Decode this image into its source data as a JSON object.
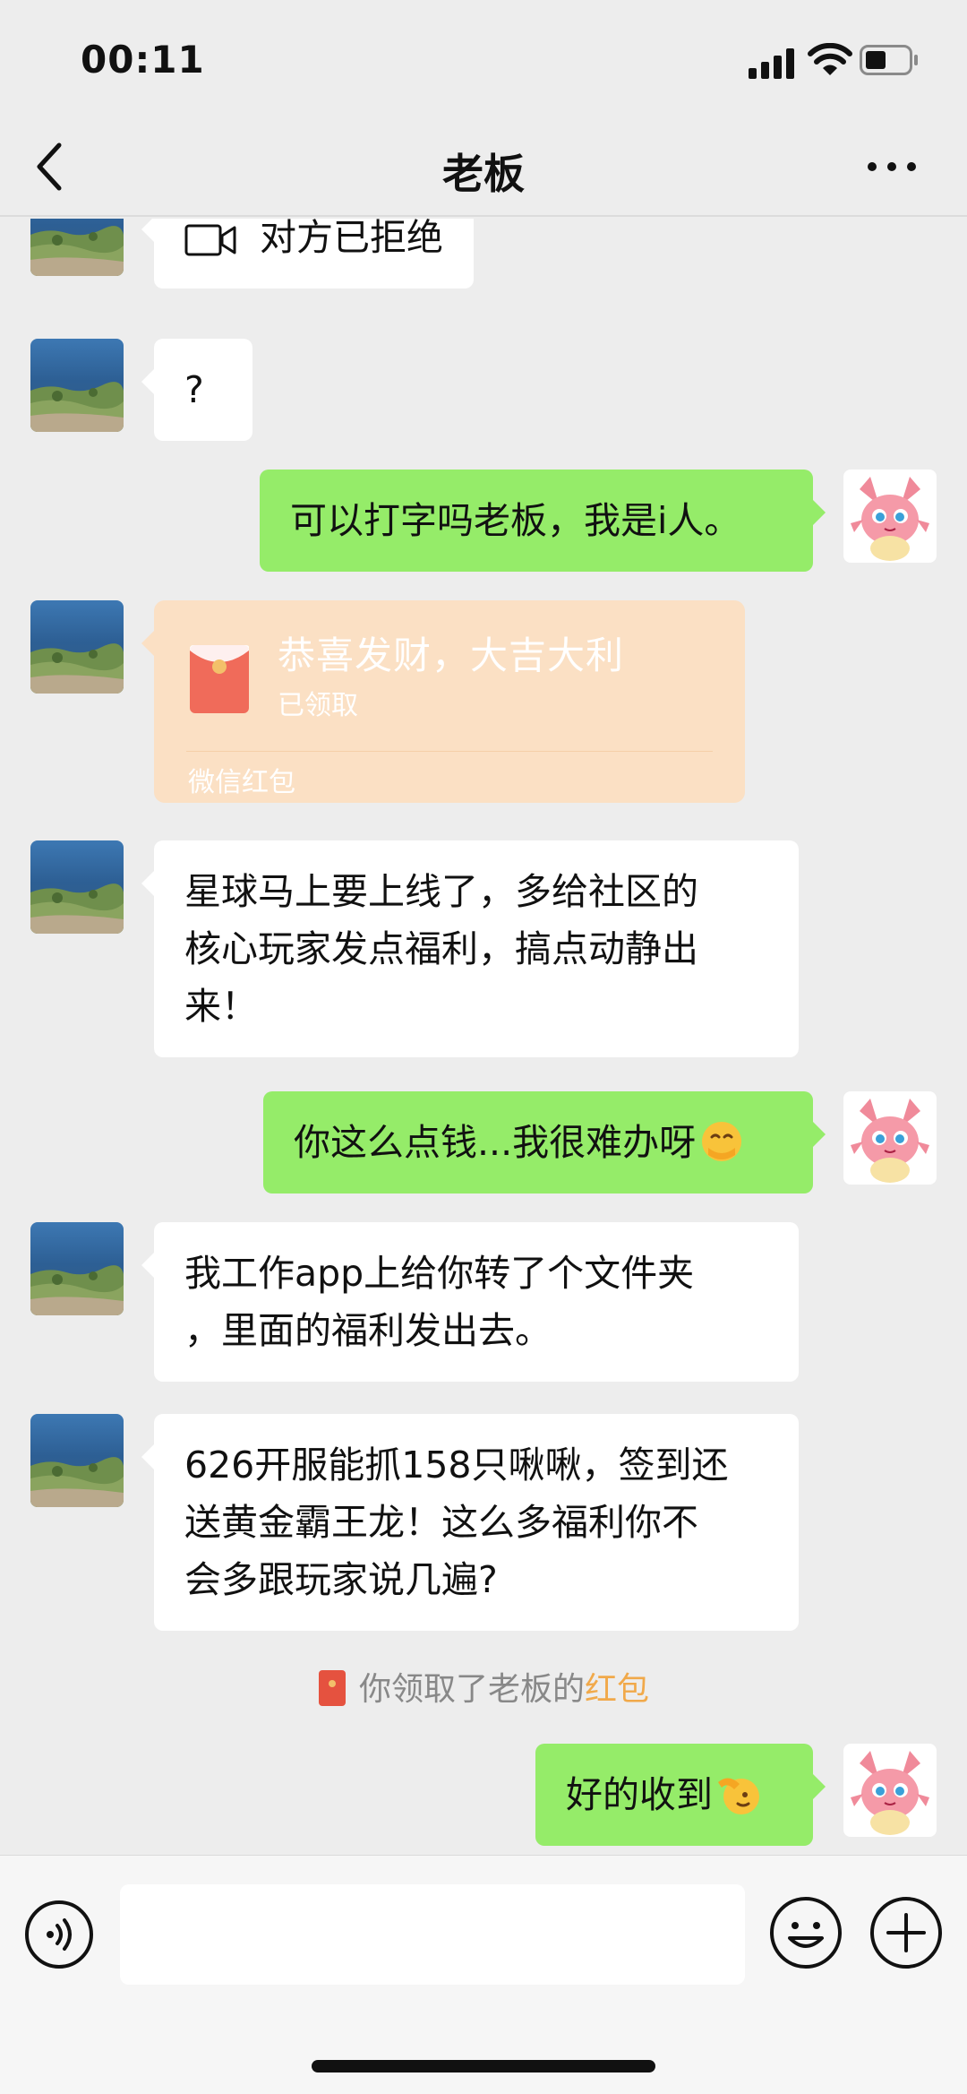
{
  "status_bar": {
    "time": "00:11"
  },
  "header": {
    "title": "老板"
  },
  "messages": {
    "m1": {
      "text": "对方已拒绝",
      "icon": "video-call-icon"
    },
    "m2": {
      "text": "?"
    },
    "m3": {
      "text": "可以打字吗老板，我是i人。"
    },
    "m4": {
      "title": "恭喜发财，大吉大利",
      "status": "已领取",
      "footer": "微信红包"
    },
    "m5": {
      "line1": "星球马上要上线了，多给社区的",
      "line2": "核心玩家发点福利，搞点动静出",
      "line3": "来！"
    },
    "m6": {
      "text": "你这么点钱...我很难办呀",
      "emoji": "hand-over-mouth-emoji"
    },
    "m7": {
      "line1": "我工作app上给你转了个文件夹",
      "line2": "，里面的福利发出去。"
    },
    "m8": {
      "line1": "626开服能抓158只啾啾，签到还",
      "line2": "送黄金霸王龙！这么多福利你不",
      "line3": "会多跟玩家说几遍?"
    },
    "notice": {
      "prefix": "你领取了老板的",
      "link": "红包"
    },
    "m9": {
      "text": "好的收到",
      "emoji": "salute-emoji"
    }
  },
  "colors": {
    "self_bubble": "#95ec69",
    "other_bubble": "#ffffff",
    "red_packet": "#fbe0c4",
    "notice_link": "#f1a94a",
    "background": "#ededed"
  }
}
